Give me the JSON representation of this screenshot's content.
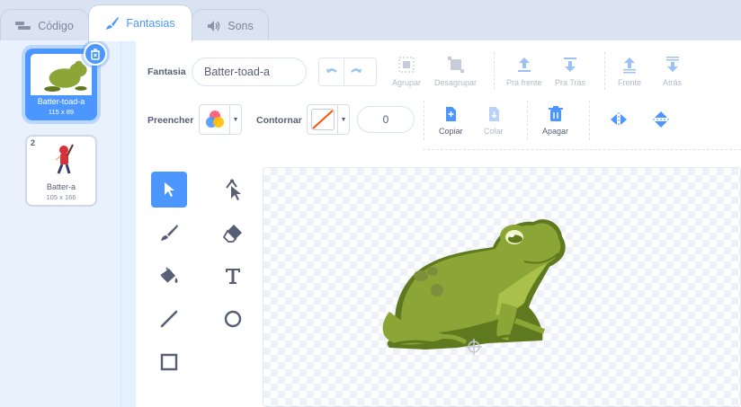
{
  "tabs": [
    {
      "label": "Código",
      "icon": "code-icon"
    },
    {
      "label": "Fantasias",
      "icon": "brush-icon"
    },
    {
      "label": "Sons",
      "icon": "speaker-icon"
    }
  ],
  "costumes": [
    {
      "number": "1",
      "name": "Batter-toad-a",
      "size": "115 x 89",
      "selected": true
    },
    {
      "number": "2",
      "name": "Batter-a",
      "size": "105 x 166",
      "selected": false
    }
  ],
  "toolbar": {
    "costume_label": "Fantasia",
    "costume_name": "Batter-toad-a",
    "group": "Agrupar",
    "ungroup": "Desagrupar",
    "forward": "Pra frente",
    "backward": "Pra Trás",
    "front": "Frente",
    "back": "Atrás",
    "fill_label": "Preencher",
    "outline_label": "Contornar",
    "outline_width": "0",
    "copy": "Copiar",
    "paste": "Colar",
    "delete": "Apagar"
  },
  "tools": [
    "select",
    "reshape",
    "brush",
    "eraser",
    "fill",
    "text",
    "line",
    "circle",
    "rectangle"
  ],
  "colors": {
    "accent": "#4c97ff",
    "toad_body": "#8ba637",
    "toad_dark": "#5f7a1e",
    "outline_none": "#ff5500"
  }
}
